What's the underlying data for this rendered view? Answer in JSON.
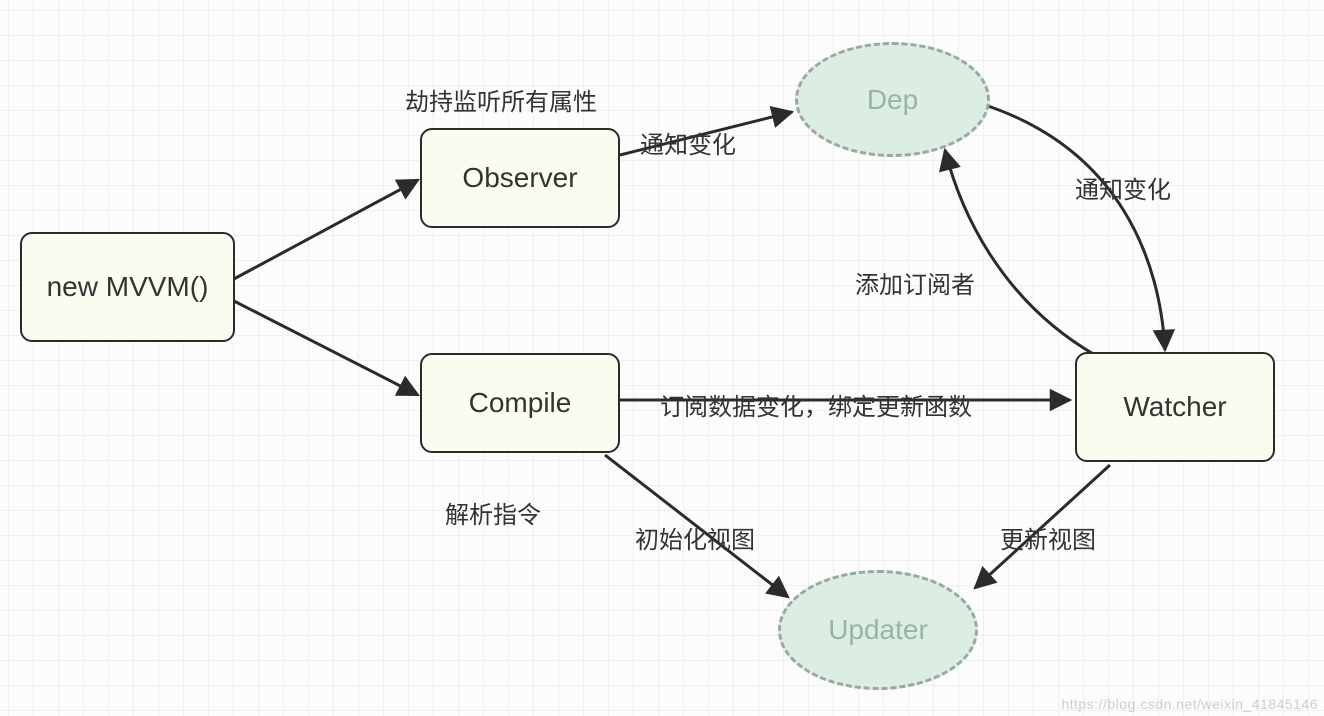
{
  "nodes": {
    "mvvm": {
      "label": "new MVVM()"
    },
    "observer": {
      "label": "Observer",
      "caption": "劫持监听所有属性"
    },
    "compile": {
      "label": "Compile",
      "caption": "解析指令"
    },
    "dep": {
      "label": "Dep"
    },
    "watcher": {
      "label": "Watcher"
    },
    "updater": {
      "label": "Updater"
    }
  },
  "edges": {
    "observer_to_dep": {
      "label": "通知变化"
    },
    "dep_to_watcher": {
      "label": "通知变化"
    },
    "watcher_to_dep": {
      "label": "添加订阅者"
    },
    "compile_to_watcher": {
      "label": "订阅数据变化，绑定更新函数"
    },
    "compile_to_updater": {
      "label": "初始化视图"
    },
    "watcher_to_updater": {
      "label": "更新视图"
    }
  },
  "watermark": "https://blog.csdn.net/weixin_41845146",
  "chart_data": {
    "type": "flowchart",
    "title": "MVVM reactive flow",
    "nodes": [
      {
        "id": "mvvm",
        "type": "rect",
        "label": "new MVVM()"
      },
      {
        "id": "observer",
        "type": "rect",
        "label": "Observer",
        "caption": "劫持监听所有属性"
      },
      {
        "id": "compile",
        "type": "rect",
        "label": "Compile",
        "caption": "解析指令"
      },
      {
        "id": "dep",
        "type": "ellipse",
        "label": "Dep"
      },
      {
        "id": "watcher",
        "type": "rect",
        "label": "Watcher"
      },
      {
        "id": "updater",
        "type": "ellipse",
        "label": "Updater"
      }
    ],
    "edges": [
      {
        "from": "mvvm",
        "to": "observer"
      },
      {
        "from": "mvvm",
        "to": "compile"
      },
      {
        "from": "observer",
        "to": "dep",
        "label": "通知变化"
      },
      {
        "from": "dep",
        "to": "watcher",
        "label": "通知变化"
      },
      {
        "from": "watcher",
        "to": "dep",
        "label": "添加订阅者"
      },
      {
        "from": "compile",
        "to": "watcher",
        "label": "订阅数据变化，绑定更新函数"
      },
      {
        "from": "compile",
        "to": "updater",
        "label": "初始化视图"
      },
      {
        "from": "watcher",
        "to": "updater",
        "label": "更新视图"
      }
    ]
  }
}
